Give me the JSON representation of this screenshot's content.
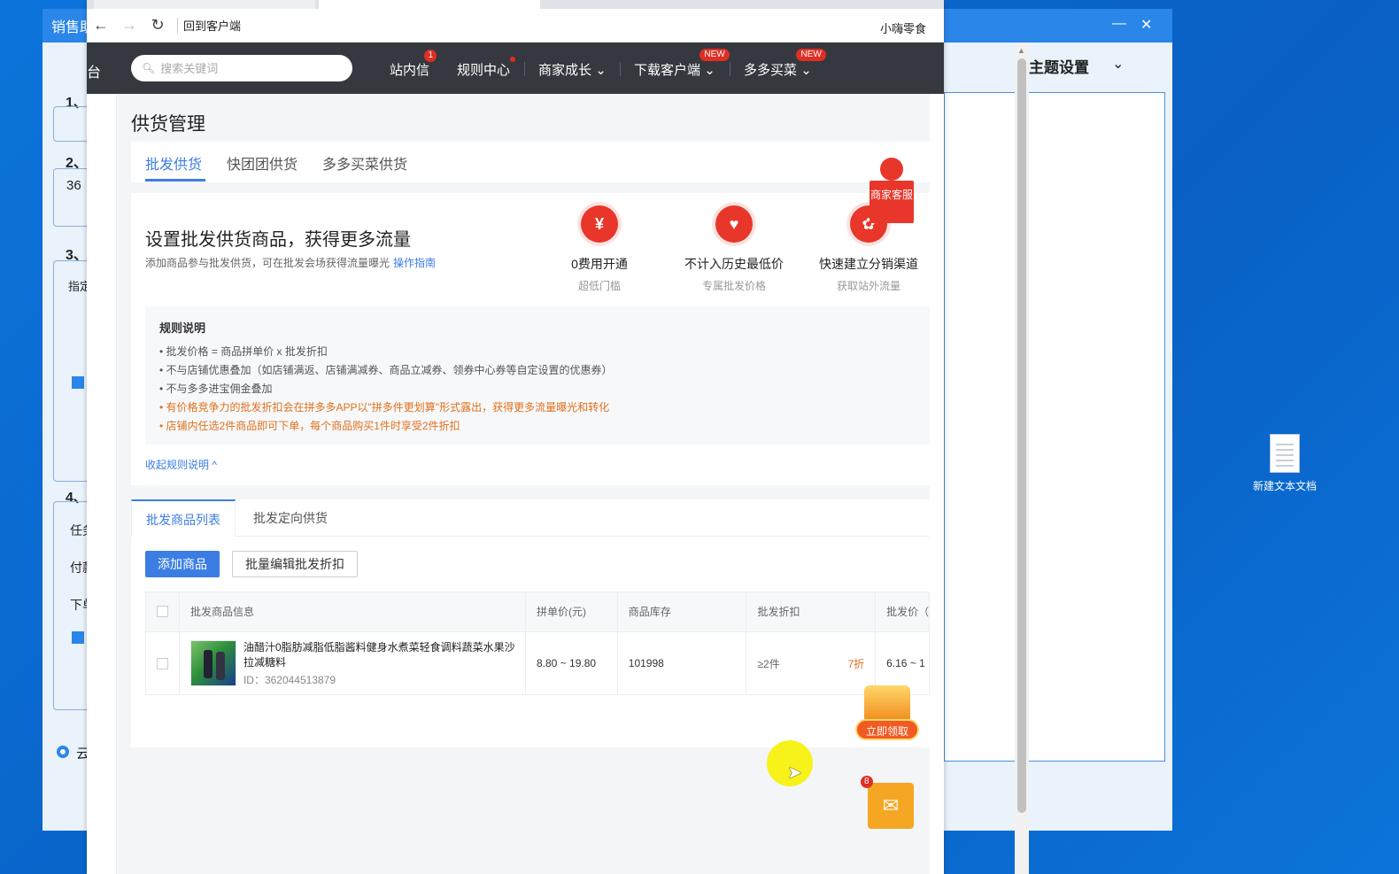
{
  "desktop": {
    "icon_label": "新建文本文档"
  },
  "bg_app": {
    "title": "销售助",
    "theme_label": "主题设置",
    "sections": [
      "1、",
      "2、",
      "3、",
      "4、"
    ],
    "field2_value": "36",
    "field3_value": "指定",
    "s4_labels": [
      "任务",
      "付款",
      "下单"
    ],
    "radio_label": "云"
  },
  "browser": {
    "address_text": "回到客户端",
    "store_name": "小嗨零食"
  },
  "site": {
    "brand_fragment": "台",
    "search_placeholder": "搜索关键词",
    "nav": [
      {
        "label": "站内信",
        "badge": "1"
      },
      {
        "label": "规则中心"
      },
      {
        "label": "商家成长",
        "chevron": "⌄"
      },
      {
        "label": "下载客户端",
        "badge_new": "NEW",
        "chevron": "⌄"
      },
      {
        "label": "多多买菜",
        "badge_new": "NEW",
        "chevron": "⌄"
      }
    ]
  },
  "page": {
    "title": "供货管理",
    "tabs": [
      "批发供货",
      "快团团供货",
      "多多买菜供货"
    ],
    "promo": {
      "headline": "设置批发供货商品，获得更多流量",
      "subline": "添加商品参与批发供货，可在批发会场获得流量曝光",
      "guide_link": "操作指南",
      "features": [
        {
          "icon": "¥",
          "title": "0费用开通",
          "sub": "超低门槛"
        },
        {
          "icon": "♥",
          "title": "不计入历史最低价",
          "sub": "专属批发价格"
        },
        {
          "icon": "✿",
          "title": "快速建立分销渠道",
          "sub": "获取站外流量"
        }
      ]
    },
    "rules": {
      "heading": "规则说明",
      "items": [
        "• 批发价格 = 商品拼单价 x 批发折扣",
        "• 不与店铺优惠叠加（如店铺满返、店铺满减券、商品立减券、领券中心券等自定设置的优惠券）",
        "• 不与多多进宝佣金叠加"
      ],
      "highlight_items": [
        "• 有价格竞争力的批发折扣会在拼多多APP以\"拼多件更划算\"形式露出，获得更多流量曝光和转化",
        "• 店铺内任选2件商品即可下单，每个商品购买1件时享受2件折扣"
      ],
      "collapse_label": "收起规则说明 ^"
    },
    "list": {
      "sub_tabs": [
        "批发商品列表",
        "批发定向供货"
      ],
      "add_button": "添加商品",
      "bulk_button": "批量编辑批发折扣",
      "columns": [
        "批发商品信息",
        "拼单价(元)",
        "商品库存",
        "批发折扣",
        "批发价（"
      ],
      "rows": [
        {
          "name": "油醋汁0脂肪减脂低脂酱料健身水煮菜轻食调料蔬菜水果沙拉减糖料",
          "id": "ID：362044513879",
          "price": "8.80 ~ 19.80",
          "stock": "101998",
          "discount_min": "≥2件",
          "discount": "7折",
          "wholesale_price": "6.16 ~ 1"
        }
      ]
    }
  },
  "widgets": {
    "service_label": "商家客服",
    "coupon_label": "立即领取",
    "mail_badge": "8"
  }
}
